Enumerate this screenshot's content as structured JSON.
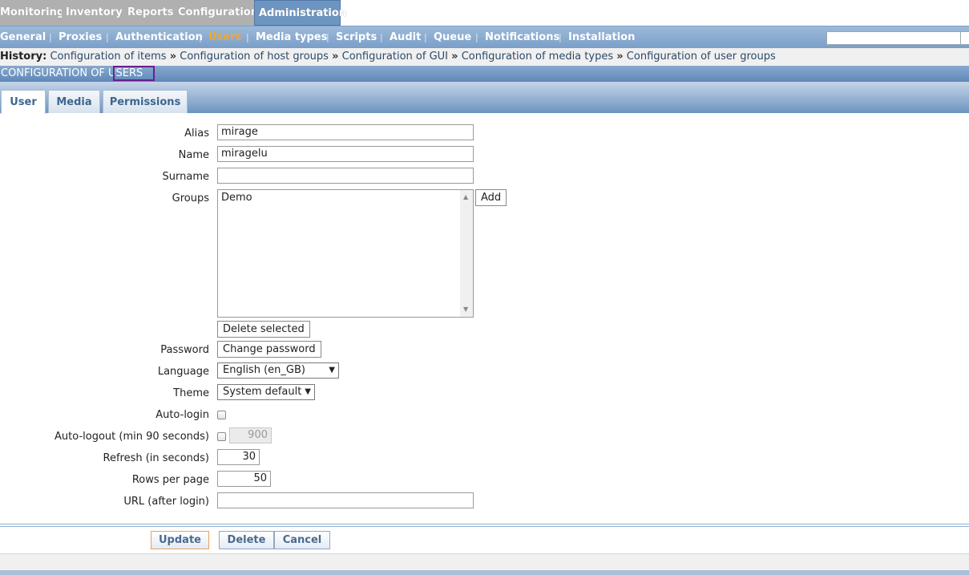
{
  "top_menu": {
    "items": [
      "Monitoring",
      "Inventory",
      "Reports",
      "Configuration",
      "Administration"
    ],
    "active": "Administration"
  },
  "sub_menu": {
    "items": [
      "General",
      "Proxies",
      "Authentication",
      "Users",
      "Media types",
      "Scripts",
      "Audit",
      "Queue",
      "Notifications",
      "Installation"
    ],
    "active": "Users"
  },
  "history": {
    "label": "History:",
    "items": [
      "Configuration of items",
      "Configuration of host groups",
      "Configuration of GUI",
      "Configuration of media types",
      "Configuration of user groups"
    ],
    "separator": "»"
  },
  "title": {
    "prefix": "CONFIGURATION OF ",
    "highlight": "USERS"
  },
  "tabs": [
    "User",
    "Media",
    "Permissions"
  ],
  "active_tab": "User",
  "form": {
    "alias": {
      "label": "Alias",
      "value": "mirage"
    },
    "name": {
      "label": "Name",
      "value": "miragelu"
    },
    "surname": {
      "label": "Surname",
      "value": ""
    },
    "groups": {
      "label": "Groups",
      "options": [
        "Demo"
      ],
      "add_label": "Add",
      "delete_label": "Delete selected"
    },
    "password": {
      "label": "Password",
      "button": "Change password"
    },
    "language": {
      "label": "Language",
      "value": "English (en_GB)"
    },
    "theme": {
      "label": "Theme",
      "value": "System default"
    },
    "autologin": {
      "label": "Auto-login",
      "checked": false
    },
    "autologout": {
      "label": "Auto-logout (min 90 seconds)",
      "checked": false,
      "value": "900"
    },
    "refresh": {
      "label": "Refresh (in seconds)",
      "value": "30"
    },
    "rows_per_page": {
      "label": "Rows per page",
      "value": "50"
    },
    "url": {
      "label": "URL (after login)",
      "value": ""
    }
  },
  "footer": {
    "update": "Update",
    "delete": "Delete",
    "cancel": "Cancel"
  },
  "colors": {
    "accent": "#6d95c1",
    "active_submenu": "#f0a830",
    "highlight_border": "#6b1f8f"
  },
  "icons": {
    "dropdown_arrow": "▼",
    "scroll_up": "▲",
    "scroll_down": "▼"
  }
}
